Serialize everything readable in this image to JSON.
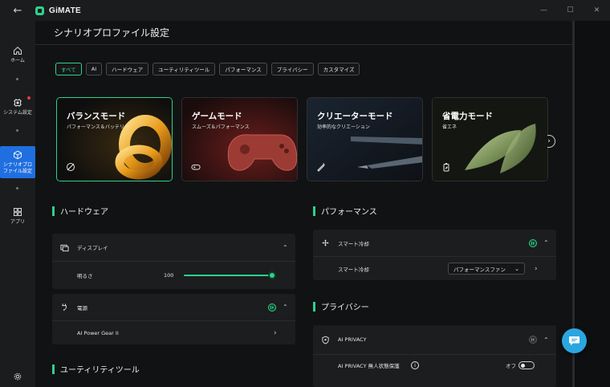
{
  "app": {
    "name": "GiMATE",
    "back_glyph": "←",
    "win_min": "—",
    "win_max": "☐",
    "win_close": "✕"
  },
  "nav": {
    "home": "ホーム",
    "system": "システム設定",
    "scenario": "シナリオプロ\nファイル設定",
    "apps": "アプリ"
  },
  "page": {
    "title": "シナリオプロファイル設定"
  },
  "filters": [
    {
      "label": "すべて",
      "active": true
    },
    {
      "label": "AI",
      "active": false
    },
    {
      "label": "ハードウェア",
      "active": false
    },
    {
      "label": "ユーティリティツール",
      "active": false
    },
    {
      "label": "パフォーマンス",
      "active": false
    },
    {
      "label": "プライバシー",
      "active": false
    },
    {
      "label": "カスタマイズ",
      "active": false
    }
  ],
  "cards": [
    {
      "title": "バランスモード",
      "subtitle": "パフォーマンス＆バッテリー",
      "icon": "no-gauge-icon",
      "active": true
    },
    {
      "title": "ゲームモード",
      "subtitle": "スムーズ＆パフォーマンス",
      "icon": "gamepad-icon",
      "active": false
    },
    {
      "title": "クリエーターモード",
      "subtitle": "効率的なクリエーション",
      "icon": "pen-icon",
      "active": false
    },
    {
      "title": "省電力モード",
      "subtitle": "省エネ",
      "icon": "battery-leaf-icon",
      "active": false
    }
  ],
  "next_glyph": "›",
  "sections": {
    "hardware": "ハードウェア",
    "performance": "パフォーマンス",
    "privacy": "プライバシー",
    "utility": "ユーティリティツール"
  },
  "hardware": {
    "display_label": "ディスプレイ",
    "brightness_label": "明るさ",
    "brightness_value": "100",
    "brightness_level": 1.0,
    "power_label": "電源",
    "power_gear_label": "AI Power Gear II"
  },
  "performance": {
    "smart_cooling_header": "スマート冷却",
    "smart_cooling_label": "スマート冷却",
    "smart_cooling_mode": "パフォーマンスファン"
  },
  "privacy": {
    "ai_privacy_header": "AI PRIVACY",
    "no_person_label": "AI PRIVACY 無人状態保護",
    "toggle_state": "オフ"
  },
  "glyphs": {
    "chev_up": "⌃",
    "chev_right": "›",
    "chev_down": "⌄",
    "info": "i"
  },
  "colors": {
    "accent": "#2fd18b",
    "nav_active": "#1f6fe0",
    "chat": "#2aa6e0"
  }
}
